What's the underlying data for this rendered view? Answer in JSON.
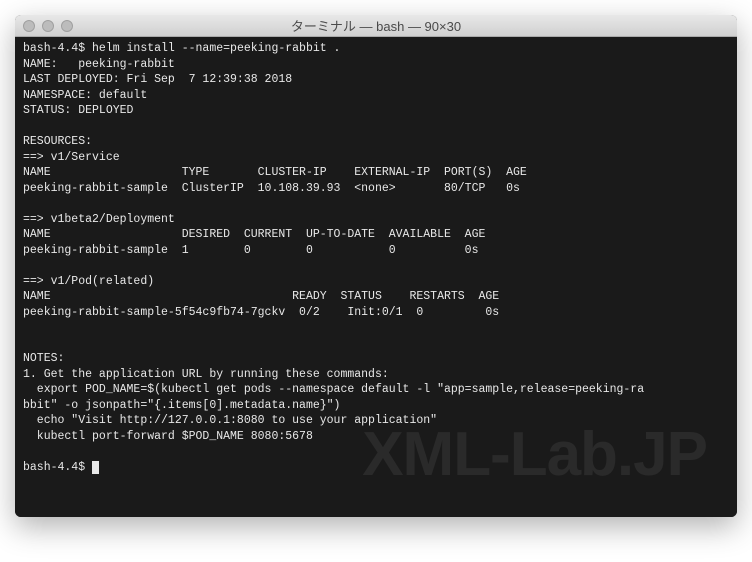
{
  "window": {
    "title": "ターミナル — bash — 90×30"
  },
  "prompt1": "bash-4.4$ ",
  "command1": "helm install --name=peeking-rabbit .",
  "output": {
    "name_line": "NAME:   peeking-rabbit",
    "last_deployed": "LAST DEPLOYED: Fri Sep  7 12:39:38 2018",
    "namespace": "NAMESPACE: default",
    "status": "STATUS: DEPLOYED",
    "resources_header": "RESOURCES:",
    "svc_header": "==> v1/Service",
    "svc_cols": "NAME                   TYPE       CLUSTER-IP    EXTERNAL-IP  PORT(S)  AGE",
    "svc_row": "peeking-rabbit-sample  ClusterIP  10.108.39.93  <none>       80/TCP   0s",
    "dep_header": "==> v1beta2/Deployment",
    "dep_cols": "NAME                   DESIRED  CURRENT  UP-TO-DATE  AVAILABLE  AGE",
    "dep_row": "peeking-rabbit-sample  1        0        0           0          0s",
    "pod_header": "==> v1/Pod(related)",
    "pod_cols": "NAME                                   READY  STATUS    RESTARTS  AGE",
    "pod_row": "peeking-rabbit-sample-5f54c9fb74-7gckv  0/2    Init:0/1  0         0s",
    "notes_header": "NOTES:",
    "notes_1": "1. Get the application URL by running these commands:",
    "notes_2": "  export POD_NAME=$(kubectl get pods --namespace default -l \"app=sample,release=peeking-ra",
    "notes_3": "bbit\" -o jsonpath=\"{.items[0].metadata.name}\")",
    "notes_4": "  echo \"Visit http://127.0.0.1:8080 to use your application\"",
    "notes_5": "  kubectl port-forward $POD_NAME 8080:5678"
  },
  "prompt2": "bash-4.4$ ",
  "watermark": "XML-Lab.JP"
}
